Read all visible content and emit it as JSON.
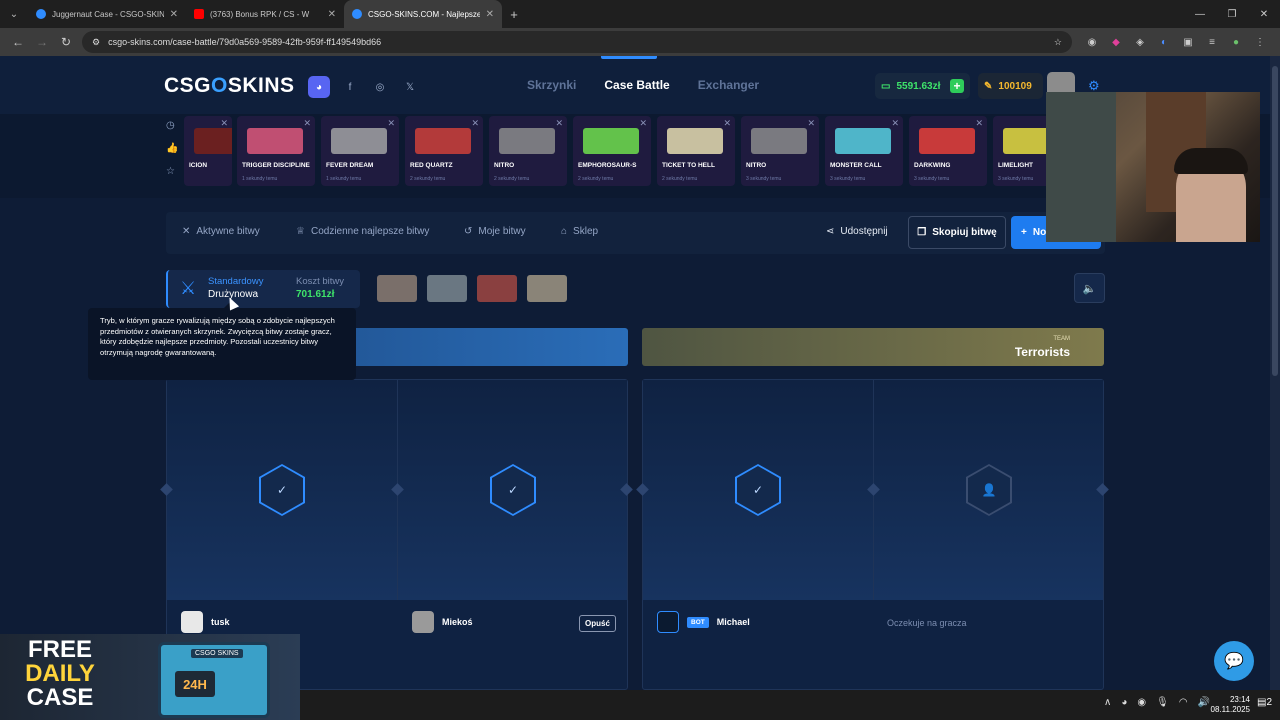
{
  "browser": {
    "tabs": [
      {
        "title": "Juggernaut Case - CSGO-SKINS",
        "favicon_color": "#2f8cff",
        "active": false
      },
      {
        "title": "(3763) Bonus RPK / CS - W",
        "favicon_color": "#ff0000",
        "active": false
      },
      {
        "title": "CSGO-SKINS.COM - Najlepsze",
        "favicon_color": "#2f8cff",
        "active": true
      }
    ],
    "url": "csgo-skins.com/case-battle/79d0a569-9589-42fb-959f-ff149549bd66"
  },
  "header": {
    "logo_left": "CSG",
    "logo_o": "O",
    "logo_right": "SKINS",
    "nav": [
      "Skrzynki",
      "Case Battle",
      "Exchanger"
    ],
    "active_nav": "Case Battle",
    "balance": "5591.63zł",
    "coins": "100109"
  },
  "cases": [
    {
      "name": "ICION",
      "sub": "",
      "color": "#6b2020"
    },
    {
      "name": "TRIGGER DISCIPLINE",
      "sub": "1 sekundy temu",
      "color": "#c04f72"
    },
    {
      "name": "FEVER DREAM",
      "sub": "1 sekundy temu",
      "color": "#8e8e95"
    },
    {
      "name": "RED QUARTZ",
      "sub": "2 sekundy temu",
      "color": "#b33a3a"
    },
    {
      "name": "NITRO",
      "sub": "2 sekundy temu",
      "color": "#7a7a80"
    },
    {
      "name": "EMPHOROSAUR-S",
      "sub": "2 sekundy temu",
      "color": "#63c24b"
    },
    {
      "name": "TICKET TO HELL",
      "sub": "2 sekundy temu",
      "color": "#c8c0a0"
    },
    {
      "name": "NITRO",
      "sub": "3 sekundy temu",
      "color": "#7a7a80"
    },
    {
      "name": "MONSTER CALL",
      "sub": "3 sekundy temu",
      "color": "#4fb5c9"
    },
    {
      "name": "DARKWING",
      "sub": "3 sekundy temu",
      "color": "#c83a3a"
    },
    {
      "name": "LIMELIGHT",
      "sub": "3 sekundy temu",
      "color": "#c8c040"
    }
  ],
  "toolbar": {
    "active_battles": "Aktywne bitwy",
    "daily_best": "Codzienne najlepsze bitwy",
    "my_battles": "Moje bitwy",
    "shop": "Sklep",
    "share": "Udostępnij",
    "copy": "Skopiuj bitwę",
    "new": "No"
  },
  "battle": {
    "mode_label": "Standardowy",
    "mode_value": "Drużynowa",
    "cost_label": "Koszt bitwy",
    "cost_value": "701.61zł",
    "tooltip": "Tryb, w którym gracze rywalizują między sobą o zdobycie najlepszych przedmiotów z otwieranych skrzynek. Zwycięzcą bitwy zostaje gracz, który zdobędzie najlepsze przedmioty. Pozostali uczestnicy bitwy otrzymują nagrodę gwarantowaną.",
    "team_label": "TEAM",
    "team_right": "Terrorists",
    "players": [
      {
        "name": "tusk",
        "bot": false
      },
      {
        "name": "Miekoś",
        "bot": false,
        "leave": "Opuść"
      },
      {
        "name": "Michael",
        "bot": true,
        "bot_label": "BOT"
      },
      {
        "waiting": "Oczekuje na gracza"
      }
    ]
  },
  "promo": {
    "l1": "FREE",
    "l2": "DAILY",
    "l3": "CASE",
    "box_label": "CSGO SKINS",
    "box_timer": "24H"
  },
  "taskbar": {
    "time": "23:14",
    "date": "08.11.2025",
    "notif_count": "2"
  }
}
